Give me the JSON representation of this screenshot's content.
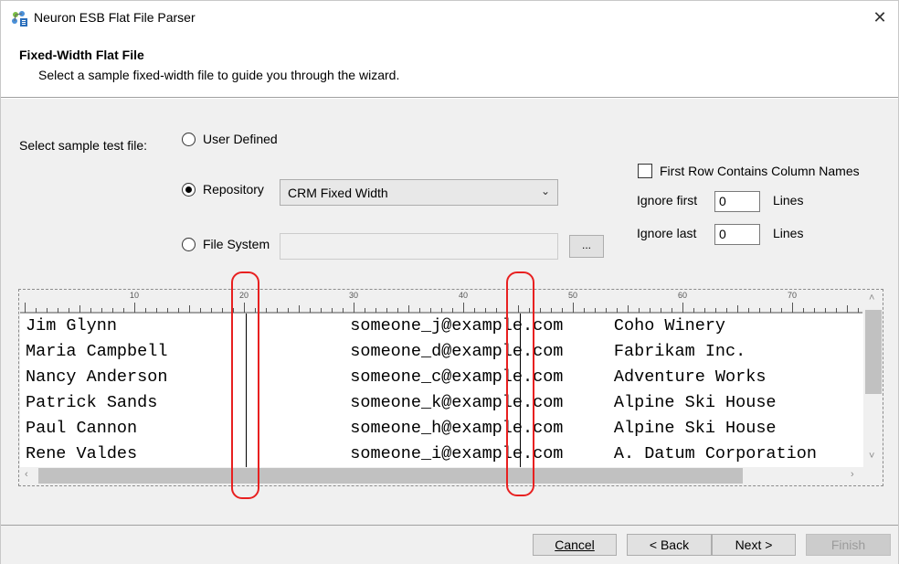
{
  "window": {
    "title": "Neuron ESB Flat File Parser",
    "close_glyph": "✕"
  },
  "header": {
    "title": "Fixed-Width Flat File",
    "subtitle": "Select a sample fixed-width file to guide you through the wizard."
  },
  "form": {
    "select_label": "Select sample test file:",
    "options": {
      "user_defined": "User Defined",
      "repository": "Repository",
      "file_system": "File System"
    },
    "selected_option": "repository",
    "repository_combo": {
      "value": "CRM Fixed Width",
      "arrow": "⌄"
    },
    "file_system_path": "",
    "browse_label": "...",
    "first_row_label": "First Row Contains Column Names",
    "first_row_checked": false,
    "ignore_first_label": "Ignore first",
    "ignore_first_value": "0",
    "ignore_last_label": "Ignore last",
    "ignore_last_value": "0",
    "lines_label": "Lines"
  },
  "ruler": {
    "labels": [
      "10",
      "20",
      "30",
      "40",
      "50",
      "60",
      "70"
    ]
  },
  "grid": {
    "rows": [
      "Jim Glynn                       someone_j@example.com     Coho Winery",
      "Maria Campbell                  someone_d@example.com     Fabrikam Inc.",
      "Nancy Anderson                  someone_c@example.com     Adventure Works",
      "Patrick Sands                   someone_k@example.com     Alpine Ski House",
      "Paul Cannon                     someone_h@example.com     Alpine Ski House",
      "Rene Valdes                     someone_i@example.com     A. Datum Corporation"
    ]
  },
  "buttons": {
    "cancel": "Cancel",
    "back": "< Back",
    "next": "Next >",
    "finish": "Finish"
  },
  "colors": {
    "highlight": "#e82020",
    "panel": "#f0f0f0"
  }
}
